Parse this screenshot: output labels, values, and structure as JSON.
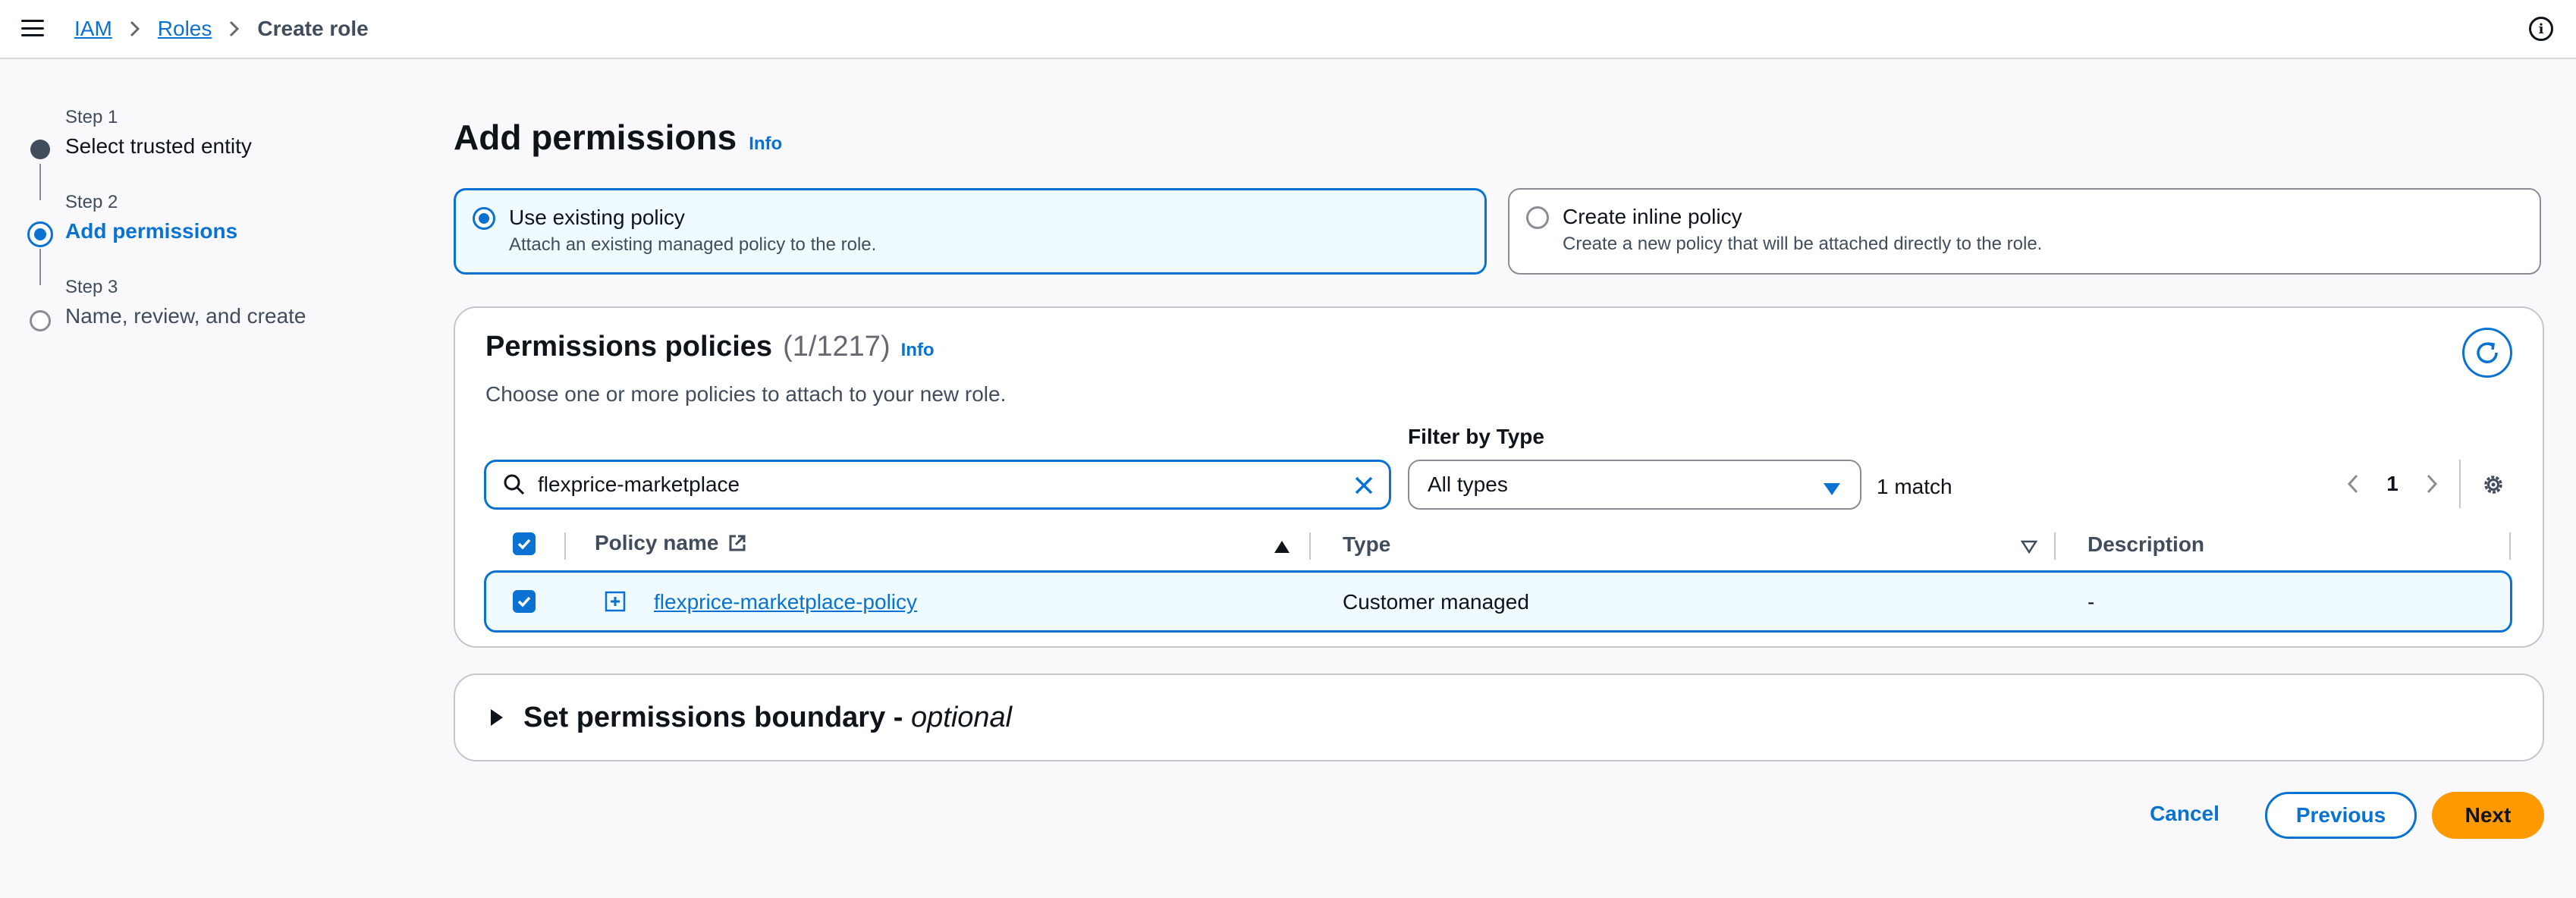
{
  "breadcrumb": {
    "items": [
      "IAM",
      "Roles"
    ],
    "current": "Create role"
  },
  "steps": [
    {
      "num": "Step 1",
      "title": "Select trusted entity",
      "state": "done"
    },
    {
      "num": "Step 2",
      "title": "Add permissions",
      "state": "active"
    },
    {
      "num": "Step 3",
      "title": "Name, review, and create",
      "state": "pending"
    }
  ],
  "page": {
    "title": "Add permissions",
    "info": "Info"
  },
  "tiles": [
    {
      "title": "Use existing policy",
      "desc": "Attach an existing managed policy to the role.",
      "selected": true
    },
    {
      "title": "Create inline policy",
      "desc": "Create a new policy that will be attached directly to the role.",
      "selected": false
    }
  ],
  "policies": {
    "title": "Permissions policies",
    "count": "(1/1217)",
    "info": "Info",
    "desc": "Choose one or more policies to attach to your new role.",
    "search_value": "flexprice-marketplace",
    "filter_label": "Filter by Type",
    "filter_value": "All types",
    "match": "1 match",
    "page": "1",
    "columns": [
      "Policy name",
      "Type",
      "Description"
    ],
    "rows": [
      {
        "name": "flexprice-marketplace-policy",
        "type": "Customer managed",
        "description": "-"
      }
    ]
  },
  "boundary": {
    "title": "Set permissions boundary - ",
    "optional": "optional"
  },
  "footer": {
    "cancel": "Cancel",
    "previous": "Previous",
    "next": "Next"
  },
  "colors": {
    "primary": "#0972d3",
    "accent": "#ff9900",
    "text": "#0f141a"
  }
}
